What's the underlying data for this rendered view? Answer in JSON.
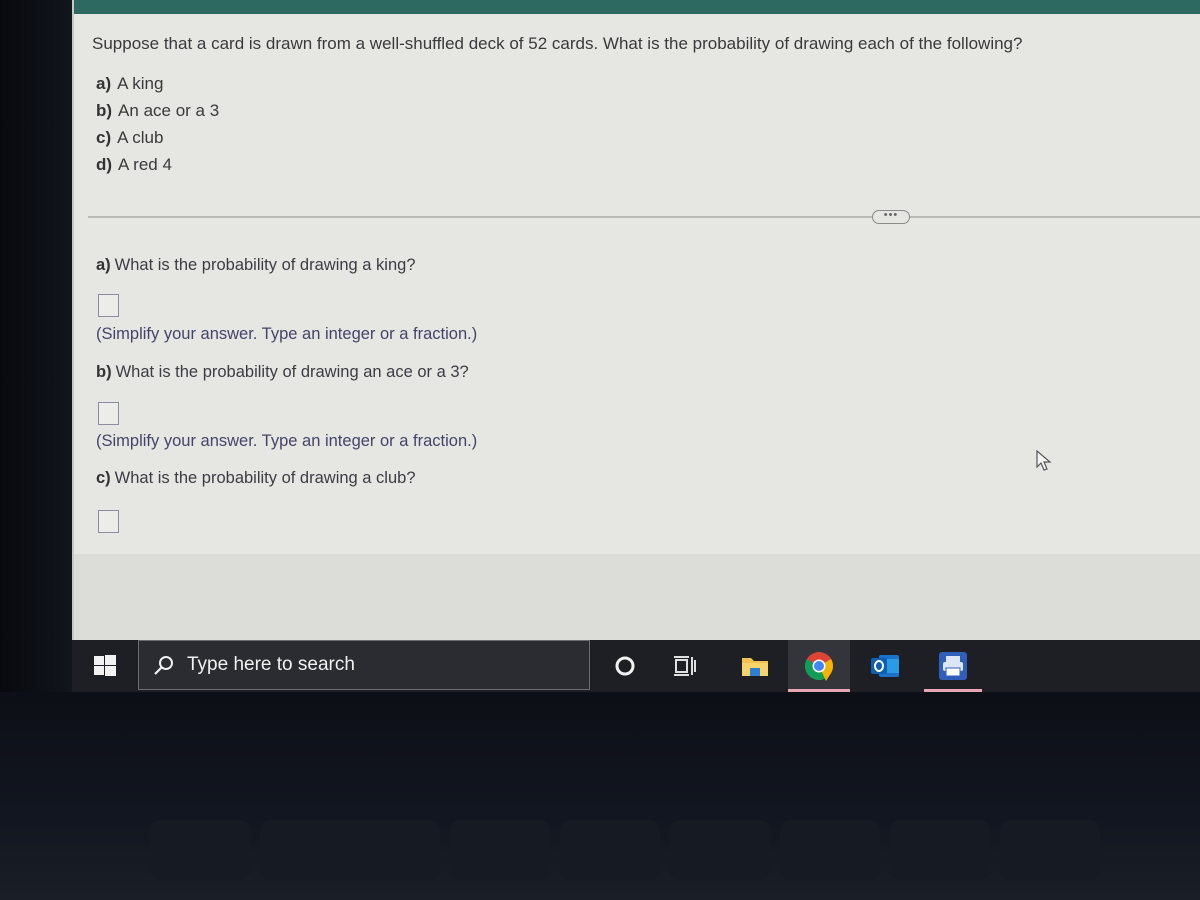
{
  "problem": {
    "prompt": "Suppose that a card is drawn from a well-shuffled deck of 52 cards. What is the probability of drawing each of the following?",
    "options": [
      {
        "letter": "a)",
        "text": "A king"
      },
      {
        "letter": "b)",
        "text": "An ace or a 3"
      },
      {
        "letter": "c)",
        "text": "A club"
      },
      {
        "letter": "d)",
        "text": "A red 4"
      }
    ],
    "more_button": "•••"
  },
  "questions": [
    {
      "letter": "a)",
      "text": "What is the probability of drawing a king?",
      "answer": "",
      "hint": "(Simplify your answer. Type an integer or a fraction.)"
    },
    {
      "letter": "b)",
      "text": "What is the probability of drawing an ace or a 3?",
      "answer": "",
      "hint": "(Simplify your answer. Type an integer or a fraction.)"
    },
    {
      "letter": "c)",
      "text": "What is the probability of drawing a club?",
      "answer": ""
    }
  ],
  "taskbar": {
    "search_placeholder": "Type here to search",
    "icons": [
      "windows-start",
      "search",
      "cortana",
      "task-view",
      "file-explorer",
      "chrome",
      "outlook",
      "print-app"
    ],
    "active": [
      "chrome",
      "print-app"
    ],
    "accent_color": "#e8a6b4"
  },
  "colors": {
    "header": "#2d6960",
    "hint_text": "#44446a"
  }
}
